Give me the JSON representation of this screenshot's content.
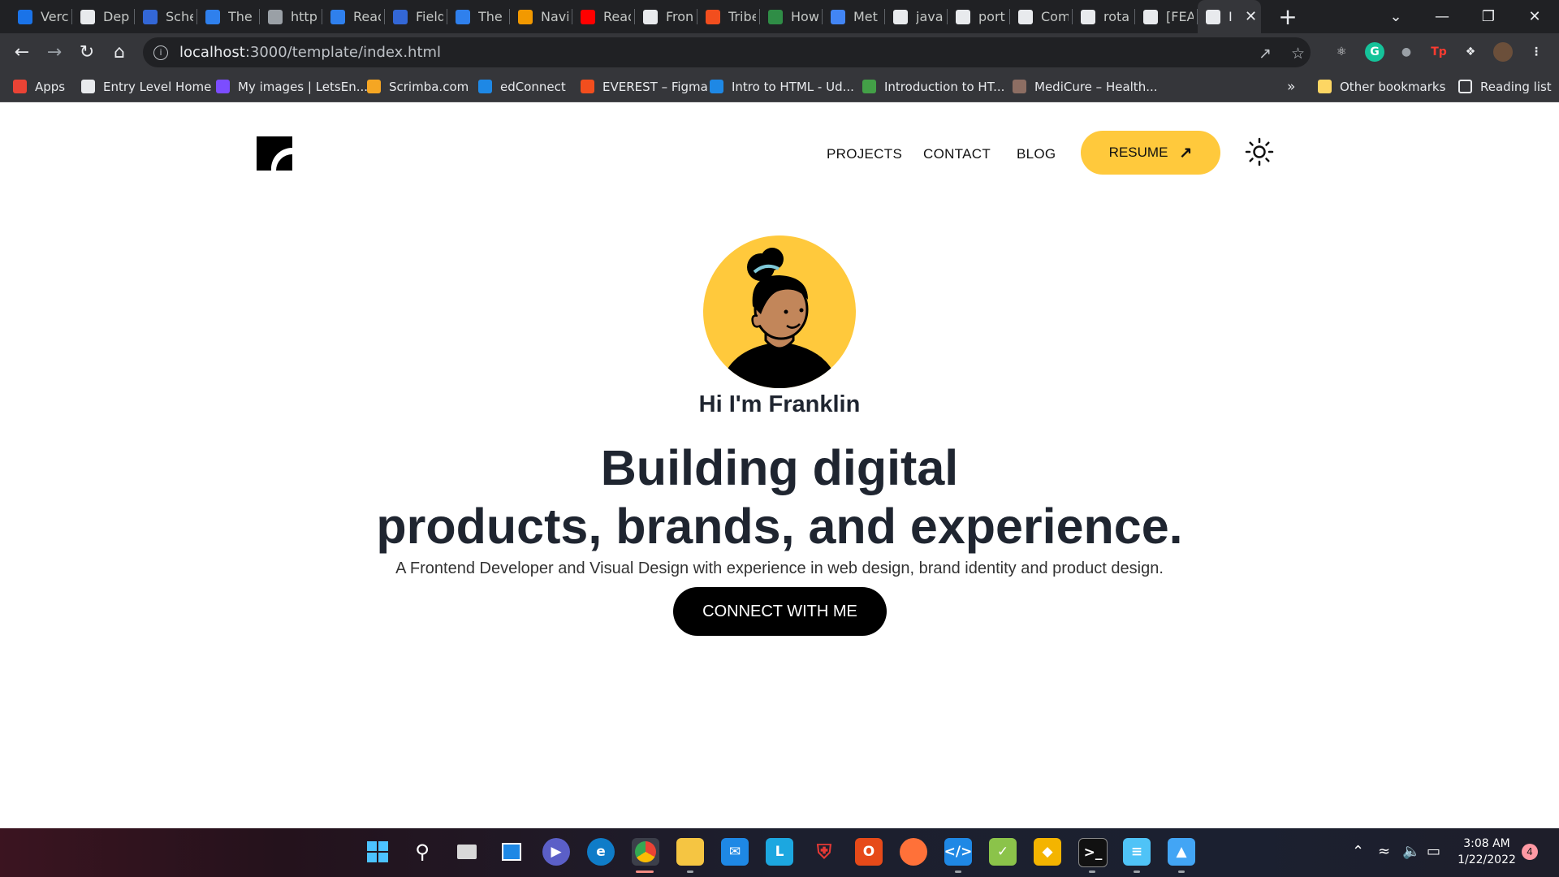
{
  "browser": {
    "tabs": [
      {
        "label": "Verc",
        "icon": "vercel-icon",
        "color": "#1a73e8"
      },
      {
        "label": "Dep",
        "icon": "github-icon",
        "color": "#e8eaed"
      },
      {
        "label": "Sche",
        "icon": "grid-icon",
        "color": "#3367d6"
      },
      {
        "label": "The",
        "icon": "bolt-icon",
        "color": "#2f80ed"
      },
      {
        "label": "http",
        "icon": "globe-icon",
        "color": "#9aa0a6"
      },
      {
        "label": "Reac",
        "icon": "bolt-icon",
        "color": "#2f80ed"
      },
      {
        "label": "Field",
        "icon": "grid-icon",
        "color": "#3367d6"
      },
      {
        "label": "The",
        "icon": "bolt-icon",
        "color": "#2f80ed"
      },
      {
        "label": "Navi",
        "icon": "bookmark-icon",
        "color": "#f29900"
      },
      {
        "label": "Reac",
        "icon": "youtube-icon",
        "color": "#ff0000"
      },
      {
        "label": "Fron",
        "icon": "doc-icon",
        "color": "#e8eaed"
      },
      {
        "label": "Tribe",
        "icon": "figma-icon",
        "color": "#f24e1e"
      },
      {
        "label": "How",
        "icon": "gfg-icon",
        "color": "#2f8d46"
      },
      {
        "label": "Met",
        "icon": "chat-icon",
        "color": "#4285f4"
      },
      {
        "label": "javas",
        "icon": "google-icon",
        "color": "#e8eaed"
      },
      {
        "label": "port",
        "icon": "google-icon",
        "color": "#e8eaed"
      },
      {
        "label": "Com",
        "icon": "github-icon",
        "color": "#e8eaed"
      },
      {
        "label": "rota",
        "icon": "drop-icon",
        "color": "#e8eaed"
      },
      {
        "label": "[FEA",
        "icon": "github-icon",
        "color": "#e8eaed"
      },
      {
        "label": "I",
        "icon": "site-icon",
        "color": "#e8eaed",
        "active": true
      }
    ],
    "new_tab": "+",
    "url_host": "localhost",
    "url_path": ":3000/template/index.html",
    "bookmarks": [
      {
        "label": "Apps",
        "color": "#ea4335"
      },
      {
        "label": "Entry Level Home",
        "color": "#e8eaed"
      },
      {
        "label": "My images | LetsEn...",
        "color": "#7c4dff"
      },
      {
        "label": "Scrimba.com",
        "color": "#f5a623"
      },
      {
        "label": "edConnect",
        "color": "#1e88e5"
      },
      {
        "label": "EVEREST – Figma",
        "color": "#f24e1e"
      },
      {
        "label": "Intro to HTML - Ud...",
        "color": "#1e88e5"
      },
      {
        "label": "Introduction to HT...",
        "color": "#43a047"
      },
      {
        "label": "MediCure – Health...",
        "color": "#8d6e63"
      }
    ],
    "bookmarks_more": "»",
    "other_bookmarks": "Other bookmarks",
    "reading_list": "Reading list"
  },
  "site": {
    "nav": {
      "projects": "PROJECTS",
      "contact": "CONTACT",
      "blog": "BLOG",
      "resume": "RESUME"
    },
    "greeting": "Hi I'm Franklin",
    "headline_line1": "Building digital",
    "headline_line2": "products, brands, and experience.",
    "subtitle": "A Frontend Developer and Visual Design with experience in web design, brand identity and product design.",
    "cta": "CONNECT WITH ME",
    "colors": {
      "accent": "#ffc93c",
      "text": "#1f2530",
      "cta_bg": "#000000"
    }
  },
  "taskbar": {
    "time": "3:08 AM",
    "date": "1/22/2022",
    "notifications": "4"
  }
}
